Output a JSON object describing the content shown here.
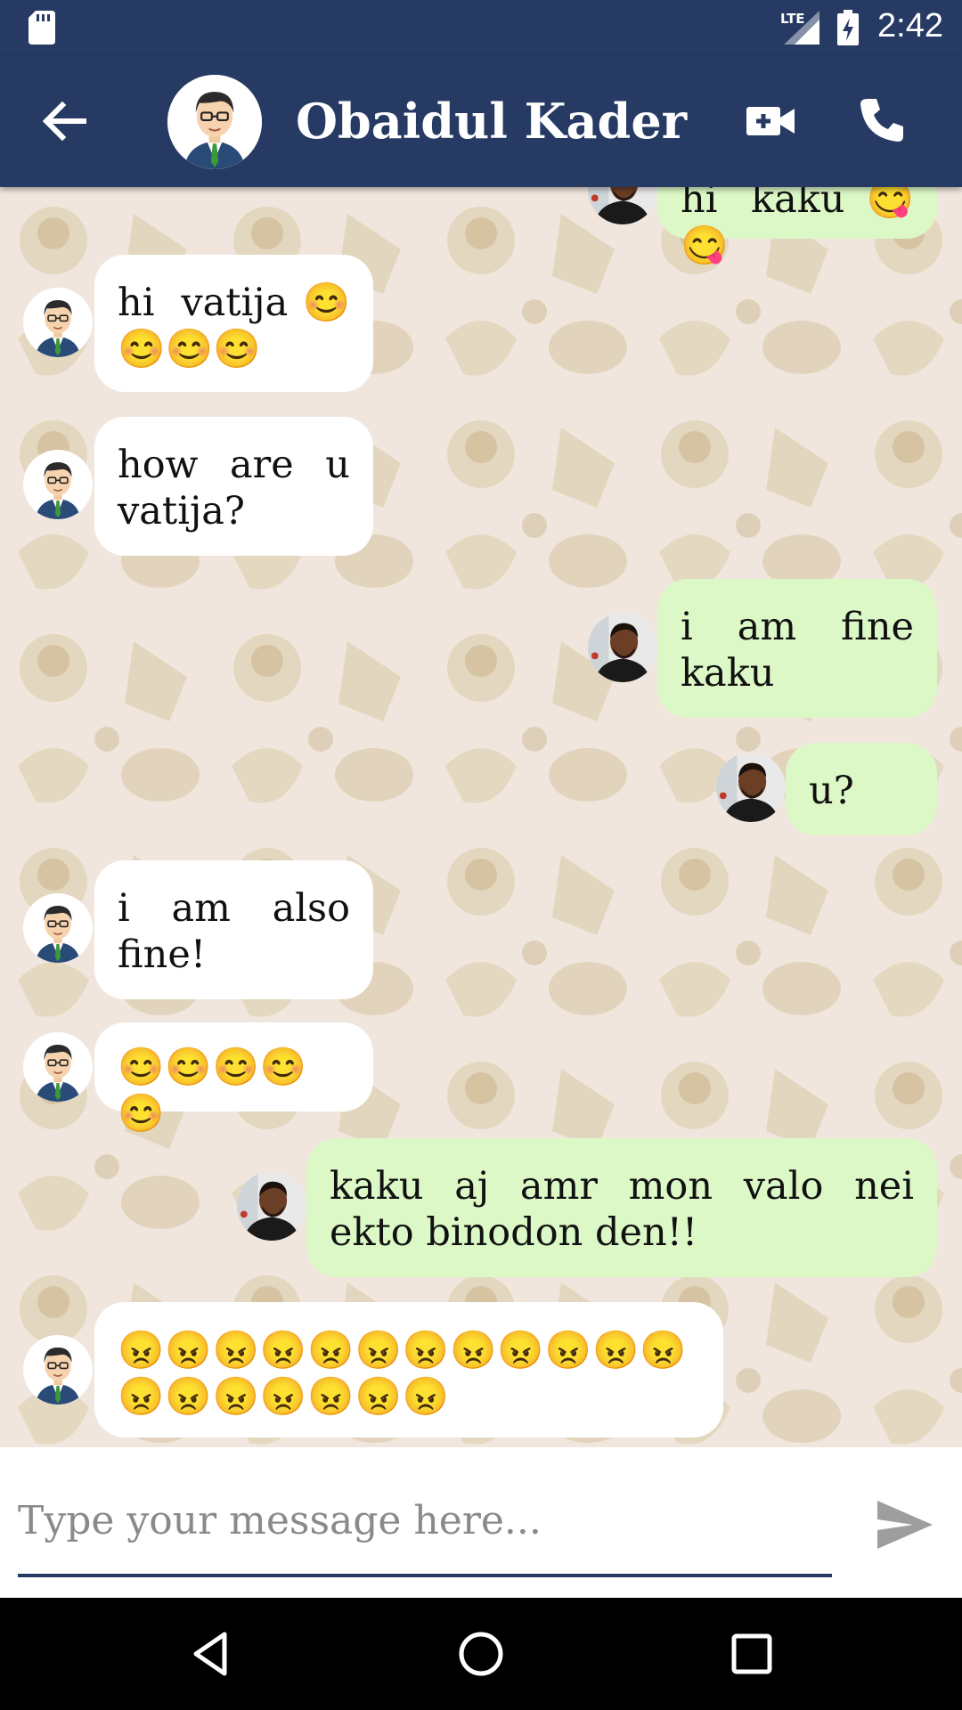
{
  "status_bar": {
    "network": "LTE",
    "time": "2:42"
  },
  "app_bar": {
    "contact_name": "Obaidul Kader",
    "icons": [
      "back-arrow-icon",
      "video-call-icon",
      "phone-icon"
    ]
  },
  "messages": [
    {
      "direction": "out",
      "text": "hi kaku😋😋"
    },
    {
      "direction": "in",
      "text": "hi vatija😊😊😊😊"
    },
    {
      "direction": "in",
      "text": "how are u vatija?"
    },
    {
      "direction": "out",
      "text": "i am fine kaku"
    },
    {
      "direction": "out",
      "text": "u?"
    },
    {
      "direction": "in",
      "text": "i am also fine!"
    },
    {
      "direction": "in",
      "text": "😊😊😊😊😊"
    },
    {
      "direction": "out",
      "text": "kaku aj amr mon valo nei ekto binodon den!!"
    },
    {
      "direction": "in",
      "text": "😠😠😠😠😠😠😠😠😠😠😠😠😠😠😠😠😠😠😠"
    }
  ],
  "input": {
    "placeholder": "Type your message here...",
    "value": ""
  },
  "colors": {
    "primary": "#263a63",
    "chat_background": "#f1e6dd",
    "incoming_bubble": "#ffffff",
    "outgoing_bubble": "#dcf8c6"
  }
}
